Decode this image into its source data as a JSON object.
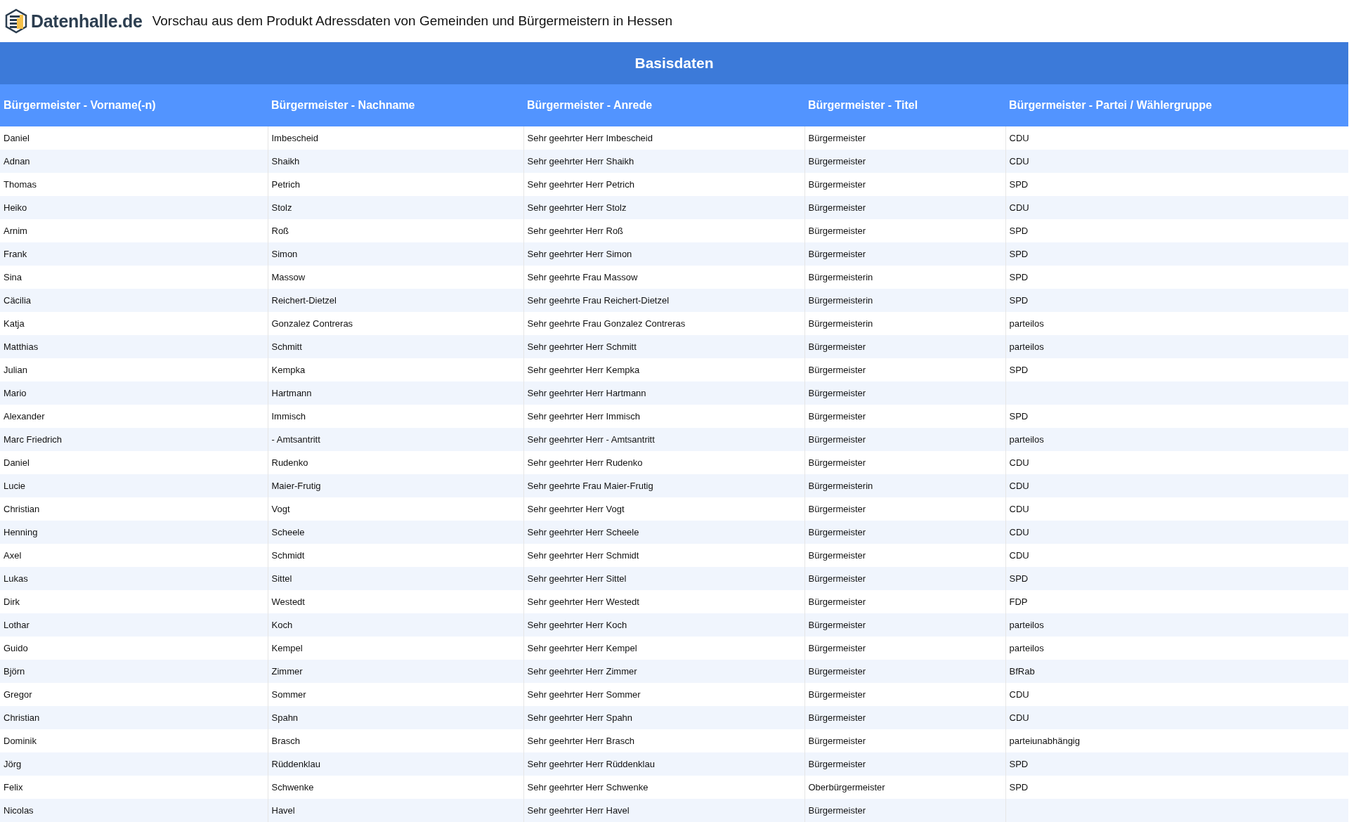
{
  "header": {
    "logo_text": "Datenhalle.de",
    "title": "Vorschau aus dem Produkt Adressdaten von Gemeinden und Bürgermeistern in Hessen"
  },
  "section_title": "Basisdaten",
  "table": {
    "columns": [
      "Bürgermeister - Vorname(-n)",
      "Bürgermeister - Nachname",
      "Bürgermeister - Anrede",
      "Bürgermeister - Titel",
      "Bürgermeister - Partei / Wählergruppe"
    ],
    "rows": [
      [
        "Daniel",
        "Imbescheid",
        "Sehr geehrter Herr Imbescheid",
        "Bürgermeister",
        "CDU"
      ],
      [
        "Adnan",
        "Shaikh",
        "Sehr geehrter Herr Shaikh",
        "Bürgermeister",
        "CDU"
      ],
      [
        "Thomas",
        "Petrich",
        "Sehr geehrter Herr Petrich",
        "Bürgermeister",
        "SPD"
      ],
      [
        "Heiko",
        "Stolz",
        "Sehr geehrter Herr Stolz",
        "Bürgermeister",
        "CDU"
      ],
      [
        "Arnim",
        "Roß",
        "Sehr geehrter Herr Roß",
        "Bürgermeister",
        "SPD"
      ],
      [
        "Frank",
        "Simon",
        "Sehr geehrter Herr Simon",
        "Bürgermeister",
        "SPD"
      ],
      [
        "Sina",
        "Massow",
        "Sehr geehrte Frau Massow",
        "Bürgermeisterin",
        "SPD"
      ],
      [
        "Cäcilia",
        "Reichert-Dietzel",
        "Sehr geehrte Frau Reichert-Dietzel",
        "Bürgermeisterin",
        "SPD"
      ],
      [
        "Katja",
        "Gonzalez Contreras",
        "Sehr geehrte Frau Gonzalez Contreras",
        "Bürgermeisterin",
        "parteilos"
      ],
      [
        "Matthias",
        "Schmitt",
        "Sehr geehrter Herr Schmitt",
        "Bürgermeister",
        "parteilos"
      ],
      [
        "Julian",
        "Kempka",
        "Sehr geehrter Herr Kempka",
        "Bürgermeister",
        "SPD"
      ],
      [
        "Mario",
        "Hartmann",
        "Sehr geehrter Herr Hartmann",
        "Bürgermeister",
        ""
      ],
      [
        "Alexander",
        "Immisch",
        "Sehr geehrter Herr Immisch",
        "Bürgermeister",
        "SPD"
      ],
      [
        "Marc Friedrich",
        "- Amtsantritt",
        "Sehr geehrter Herr - Amtsantritt",
        "Bürgermeister",
        "parteilos"
      ],
      [
        "Daniel",
        "Rudenko",
        "Sehr geehrter Herr Rudenko",
        "Bürgermeister",
        "CDU"
      ],
      [
        "Lucie",
        "Maier-Frutig",
        "Sehr geehrte Frau Maier-Frutig",
        "Bürgermeisterin",
        "CDU"
      ],
      [
        "Christian",
        "Vogt",
        "Sehr geehrter Herr Vogt",
        "Bürgermeister",
        "CDU"
      ],
      [
        "Henning",
        "Scheele",
        "Sehr geehrter Herr Scheele",
        "Bürgermeister",
        "CDU"
      ],
      [
        "Axel",
        "Schmidt",
        "Sehr geehrter Herr Schmidt",
        "Bürgermeister",
        "CDU"
      ],
      [
        "Lukas",
        "Sittel",
        "Sehr geehrter Herr Sittel",
        "Bürgermeister",
        "SPD"
      ],
      [
        "Dirk",
        "Westedt",
        "Sehr geehrter Herr Westedt",
        "Bürgermeister",
        "FDP"
      ],
      [
        "Lothar",
        "Koch",
        "Sehr geehrter Herr Koch",
        "Bürgermeister",
        "parteilos"
      ],
      [
        "Guido",
        "Kempel",
        "Sehr geehrter Herr Kempel",
        "Bürgermeister",
        "parteilos"
      ],
      [
        "Björn",
        "Zimmer",
        "Sehr geehrter Herr Zimmer",
        "Bürgermeister",
        "BfRab"
      ],
      [
        "Gregor",
        "Sommer",
        "Sehr geehrter Herr Sommer",
        "Bürgermeister",
        "CDU"
      ],
      [
        "Christian",
        "Spahn",
        "Sehr geehrter Herr Spahn",
        "Bürgermeister",
        "CDU"
      ],
      [
        "Dominik",
        "Brasch",
        "Sehr geehrter Herr Brasch",
        "Bürgermeister",
        "parteiunabhängig"
      ],
      [
        "Jörg",
        "Rüddenklau",
        "Sehr geehrter Herr Rüddenklau",
        "Bürgermeister",
        "SPD"
      ],
      [
        "Felix",
        "Schwenke",
        "Sehr geehrter Herr Schwenke",
        "Oberbürgermeister",
        "SPD"
      ],
      [
        "Nicolas",
        "Havel",
        "Sehr geehrter Herr Havel",
        "Bürgermeister",
        ""
      ]
    ]
  }
}
